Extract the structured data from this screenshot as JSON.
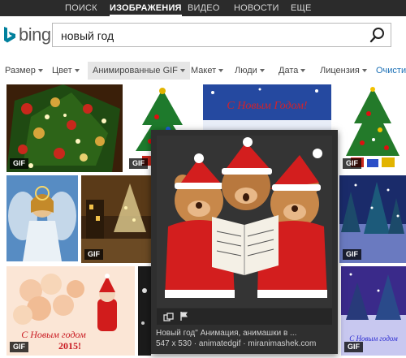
{
  "nav": {
    "tabs": [
      {
        "label": "ПОИСК",
        "active": false
      },
      {
        "label": "ИЗОБРАЖЕНИЯ",
        "active": true
      },
      {
        "label": "ВИДЕО",
        "active": false
      },
      {
        "label": "НОВОСТИ",
        "active": false
      },
      {
        "label": "ЕЩЕ",
        "active": false
      }
    ]
  },
  "brand": {
    "name": "bing",
    "icon": "bing-logo-icon",
    "accent": "#00809d"
  },
  "search": {
    "query": "новый год",
    "icon": "search-icon"
  },
  "filters": [
    {
      "label": "Размер",
      "dropdown": true
    },
    {
      "label": "Цвет",
      "dropdown": true
    },
    {
      "label": "Анимированные GIF",
      "dropdown": true,
      "active": true
    },
    {
      "label": "Макет",
      "dropdown": true
    },
    {
      "label": "Люди",
      "dropdown": true
    },
    {
      "label": "Дата",
      "dropdown": true
    },
    {
      "label": "Лицензия",
      "dropdown": true
    },
    {
      "label": "Очистит",
      "dropdown": false
    }
  ],
  "results": {
    "badge": "GIF",
    "tiles": [
      {
        "name": "christmas-tree-lights",
        "badge": true
      },
      {
        "name": "decorated-tree-small",
        "badge": true
      },
      {
        "name": "novym-godom-banner",
        "badge": false
      },
      {
        "name": "tree-with-gifts",
        "badge": true
      },
      {
        "name": "angel-girl",
        "badge": false
      },
      {
        "name": "night-town-tree",
        "badge": true
      },
      {
        "name": "blue-night-trees",
        "badge": true
      },
      {
        "name": "roses-santa-2015",
        "badge": true
      },
      {
        "name": "dark-strip",
        "badge": false
      },
      {
        "name": "purple-winter-night",
        "badge": true
      }
    ],
    "tile_texts": {
      "novym_godom": "С Новым Годом!",
      "roses_greeting": "С Новым годом",
      "roses_year": "2015!",
      "purple_greeting": "С Новым годом"
    }
  },
  "preview": {
    "caption_title": "Новый год\" Анимация, анимашки в ...",
    "caption_meta": "547 x 530 · animatedgif · miranimashek.com",
    "tools": [
      {
        "icon": "similar-images-icon"
      },
      {
        "icon": "flag-icon"
      }
    ]
  }
}
